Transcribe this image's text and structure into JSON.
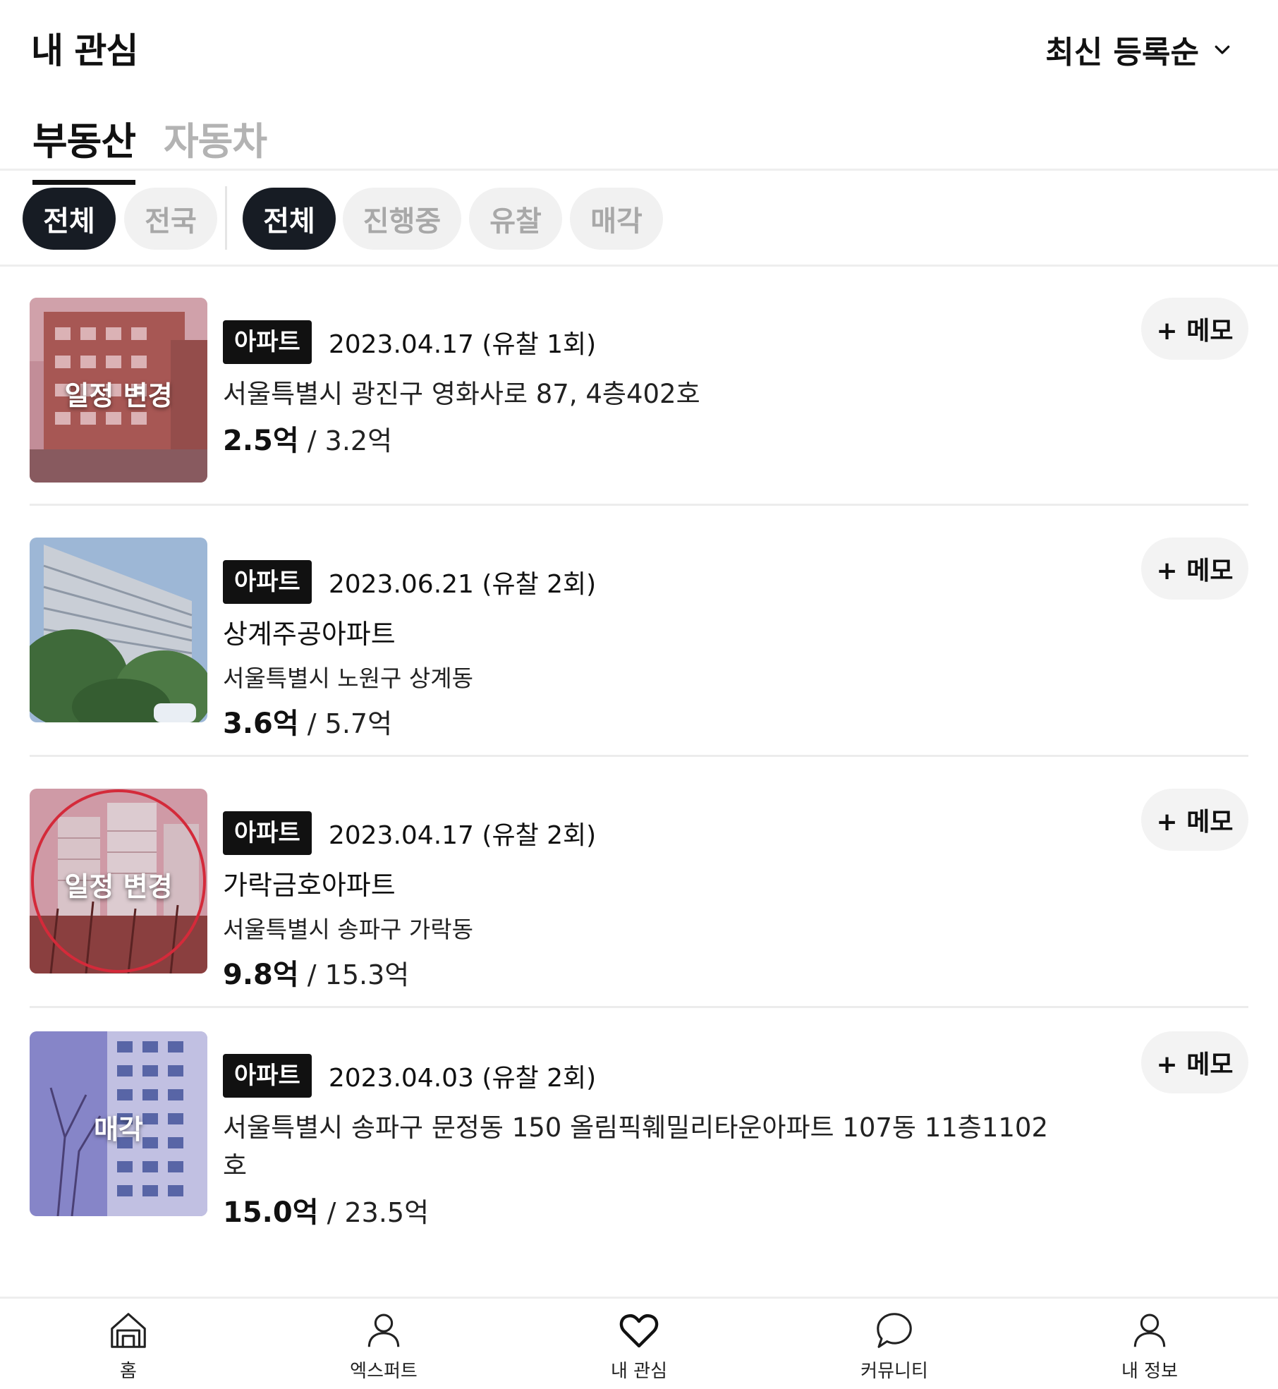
{
  "header": {
    "title": "내 관심",
    "sort_label": "최신 등록순"
  },
  "tabs": [
    {
      "label": "부동산"
    },
    {
      "label": "자동차"
    }
  ],
  "filters": {
    "region": [
      {
        "label": "전체"
      },
      {
        "label": "전국"
      }
    ],
    "status": [
      {
        "label": "전체"
      },
      {
        "label": "진행중"
      },
      {
        "label": "유찰"
      },
      {
        "label": "매각"
      }
    ]
  },
  "items": [
    {
      "type": "아파트",
      "date": "2023.04.17 (유찰 1회)",
      "name": "",
      "address": "서울특별시 광진구 영화사로 87, 4층402호",
      "min_price": "2.5억",
      "sep": " / ",
      "appraisal": "3.2억",
      "thumb_label": "일정 변경",
      "memo_label": "+ 메모"
    },
    {
      "type": "아파트",
      "date": "2023.06.21 (유찰 2회)",
      "name": "상계주공아파트",
      "address": "서울특별시 노원구 상계동",
      "min_price": "3.6억",
      "sep": " / ",
      "appraisal": "5.7억",
      "thumb_label": "",
      "memo_label": "+ 메모"
    },
    {
      "type": "아파트",
      "date": "2023.04.17 (유찰 2회)",
      "name": "가락금호아파트",
      "address": "서울특별시 송파구 가락동",
      "min_price": "9.8억",
      "sep": " / ",
      "appraisal": "15.3억",
      "thumb_label": "일정 변경",
      "memo_label": "+ 메모"
    },
    {
      "type": "아파트",
      "date": "2023.04.03 (유찰 2회)",
      "name": "",
      "address": "서울특별시 송파구 문정동 150 올림픽훼밀리타운아파트 107동 11층1102호",
      "min_price": "15.0억",
      "sep": " / ",
      "appraisal": "23.5억",
      "thumb_label": "매각",
      "memo_label": "+ 메모"
    }
  ],
  "bottom_nav": [
    {
      "label": "홈",
      "icon": "home-icon"
    },
    {
      "label": "엑스퍼트",
      "icon": "expert-icon"
    },
    {
      "label": "내 관심",
      "icon": "heart-icon"
    },
    {
      "label": "커뮤니티",
      "icon": "chat-bubble-icon"
    },
    {
      "label": "내 정보",
      "icon": "profile-icon"
    }
  ],
  "colors": {
    "chip_dark": "#171c24",
    "chip_light": "#f1f1f1",
    "badge": "#111111",
    "divider": "#eeeeee"
  }
}
